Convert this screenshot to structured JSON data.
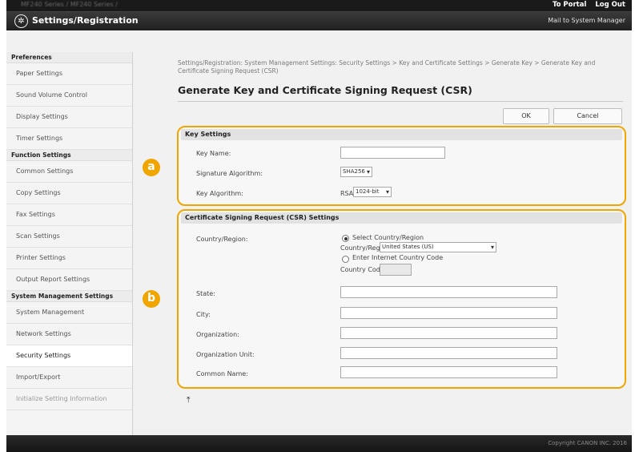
{
  "topbar": {
    "model": "MF240 Series / MF240 Series /",
    "portal": "To Portal",
    "logout": "Log Out"
  },
  "header": {
    "title": "Settings/Registration",
    "mail": "Mail to System Manager",
    "icon": "settings-gear-icon"
  },
  "sidebar": {
    "preferences": "Preferences",
    "pref_items": [
      "Paper Settings",
      "Sound Volume Control",
      "Display Settings",
      "Timer Settings"
    ],
    "function": "Function Settings",
    "func_items": [
      "Common Settings",
      "Copy Settings",
      "Fax Settings",
      "Scan Settings",
      "Printer Settings",
      "Output Report Settings"
    ],
    "system": "System Management Settings",
    "sys_items": [
      "System Management",
      "Network Settings",
      "Security Settings",
      "Import/Export",
      "Initialize Setting Information"
    ]
  },
  "main": {
    "breadcrumb": "Settings/Registration: System Management Settings: Security Settings > Key and Certificate Settings > Generate Key > Generate Key and Certificate Signing Request (CSR)",
    "title": "Generate Key and Certificate Signing Request (CSR)",
    "ok": "OK",
    "cancel": "Cancel"
  },
  "key_settings": {
    "head": "Key Settings",
    "key_name": "Key Name:",
    "sig_algo": "Signature Algorithm:",
    "sig_value": "SHA256",
    "key_algo": "Key Algorithm:",
    "key_type": "RSA",
    "key_value": "1024-bit"
  },
  "csr": {
    "head": "Certificate Signing Request (CSR) Settings",
    "country_region": "Country/Region:",
    "select_country": "Select Country/Region",
    "country_region_sub": "Country/Region:",
    "country_value": "United States (US)",
    "enter_code": "Enter Internet Country Code",
    "country_code": "Country Code:",
    "state": "State:",
    "city": "City:",
    "organization": "Organization:",
    "org_unit": "Organization Unit:",
    "common_name": "Common Name:"
  },
  "badges": {
    "a": "a",
    "b": "b"
  },
  "footer": {
    "copyright": "Copyright CANON INC. 2016"
  },
  "colors": {
    "accent": "#f0a500",
    "header": "#202020"
  }
}
